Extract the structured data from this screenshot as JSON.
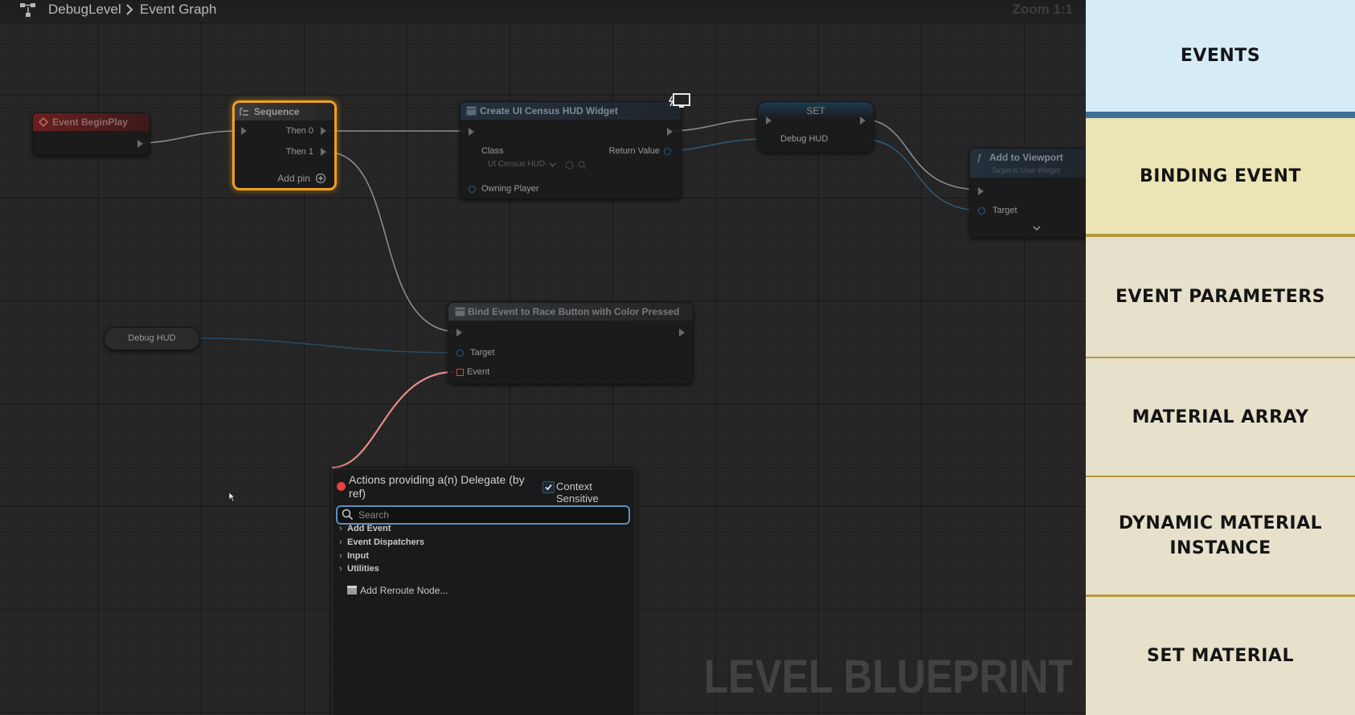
{
  "breadcrumb": {
    "level": "DebugLevel",
    "graph": "Event Graph"
  },
  "zoom_label": "Zoom 1:1",
  "nodes": {
    "begin_play": {
      "title": "Event BeginPlay"
    },
    "sequence": {
      "title": "Sequence",
      "then0": "Then 0",
      "then1": "Then 1",
      "add_pin": "Add pin"
    },
    "create_widget": {
      "title": "Create UI Census HUD Widget",
      "class_label": "Class",
      "class_value": "UI Census HUD",
      "return_label": "Return Value",
      "owning_player": "Owning Player"
    },
    "set_node": {
      "title": "SET",
      "var": "Debug HUD"
    },
    "add_viewport": {
      "title": "Add to Viewport",
      "subtitle": "Target is User Widget",
      "target": "Target"
    },
    "bind_event": {
      "title": "Bind Event to Race Button with Color Pressed",
      "target": "Target",
      "event": "Event"
    },
    "debug_hud_getter": {
      "label": "Debug HUD"
    }
  },
  "context_menu": {
    "title": "Actions providing a(n) Delegate (by ref)",
    "context_sensitive_label": "Context Sensitive",
    "context_sensitive_checked": true,
    "search_placeholder": "Search",
    "categories": [
      "Add Event",
      "Event Dispatchers",
      "Input",
      "Utilities"
    ],
    "reroute_label": "Add Reroute Node..."
  },
  "watermark": "LEVEL BLUEPRINT",
  "panel": {
    "sections": [
      {
        "label": "EVENTS",
        "bg": "#d5ebf7"
      },
      {
        "label": "BINDING EVENT",
        "bg": "#ebe4b5"
      },
      {
        "label": "EVENT PARAMETERS",
        "bg": "#e7e1cc"
      },
      {
        "label": "MATERIAL ARRAY",
        "bg": "#e7e1cc"
      },
      {
        "label": "DYNAMIC MATERIAL INSTANCE",
        "bg": "#e7e1cc"
      },
      {
        "label": "SET MATERIAL",
        "bg": "#e7e1cc"
      }
    ],
    "divider_color": "#b49a3c",
    "events_divider_color": "#3f6f96"
  },
  "colors": {
    "delegate_wire": "#e88a8a",
    "exec_wire": "#8c8c8c",
    "object_wire": "#2f5f80",
    "sequence_highlight": "#f0a020",
    "event_header": "#6b1f1f",
    "function_header": "#24303c"
  }
}
